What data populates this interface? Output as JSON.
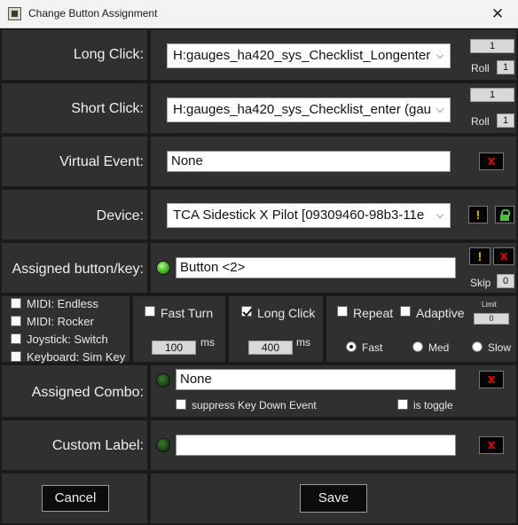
{
  "window": {
    "title": "Change Button Assignment",
    "close_icon": "✕"
  },
  "long_click": {
    "label": "Long Click:",
    "selected": "H:gauges_ha420_sys_Checklist_Longenter",
    "count": "1",
    "roll_label": "Roll",
    "roll_value": "1"
  },
  "short_click": {
    "label": "Short Click:",
    "selected": "H:gauges_ha420_sys_Checklist_enter (gau",
    "count": "1",
    "roll_label": "Roll",
    "roll_value": "1"
  },
  "virtual_event": {
    "label": "Virtual Event:",
    "value": "None",
    "clear_label": "x"
  },
  "device": {
    "label": "Device:",
    "selected": "TCA Sidestick X Pilot [09309460-98b3-11e",
    "warn_label": "!"
  },
  "assigned_button": {
    "label": "Assigned button/key:",
    "value": "Button <2>",
    "warn_label": "!",
    "clear_label": "x",
    "skip_label": "Skip",
    "skip_value": "0"
  },
  "modes": [
    {
      "label": "MIDI: Endless",
      "checked": false
    },
    {
      "label": "MIDI: Rocker",
      "checked": false
    },
    {
      "label": "Joystick: Switch",
      "checked": false
    },
    {
      "label": "Keyboard: Sim Key",
      "checked": false
    }
  ],
  "fast_turn": {
    "label": "Fast Turn",
    "value": "100",
    "unit": "ms",
    "checked": false
  },
  "long_click_opt": {
    "label": "Long Click",
    "value": "400",
    "unit": "ms",
    "checked": true
  },
  "repeat": {
    "repeat_label": "Repeat",
    "adaptive_label": "Adaptive",
    "limit_label": "Limit",
    "limit_value": "0",
    "speeds": [
      {
        "label": "Fast",
        "selected": true
      },
      {
        "label": "Med",
        "selected": false
      },
      {
        "label": "Slow",
        "selected": false
      }
    ]
  },
  "assigned_combo": {
    "label": "Assigned Combo:",
    "value": "None",
    "clear_label": "x",
    "suppress_label": "suppress Key Down Event",
    "toggle_label": "is toggle"
  },
  "custom_label": {
    "label": "Custom Label:",
    "value": "",
    "clear_label": "x"
  },
  "footer": {
    "cancel_label": "Cancel",
    "save_label": "Save"
  }
}
